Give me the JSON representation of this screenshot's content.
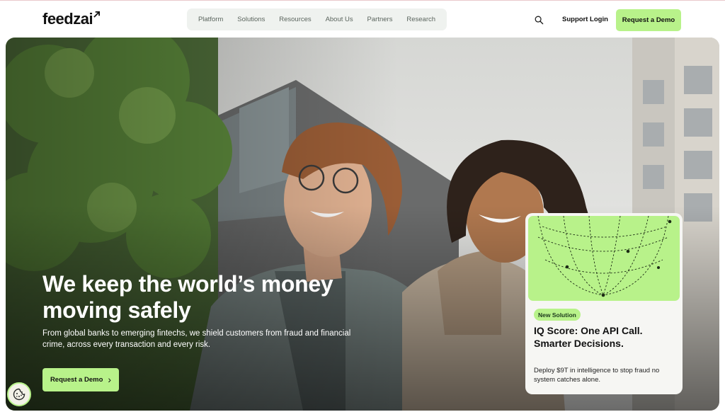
{
  "header": {
    "logo_text": "feedzai",
    "nav": [
      "Platform",
      "Solutions",
      "Resources",
      "About Us",
      "Partners",
      "Research"
    ],
    "support_label": "Support Login",
    "demo_label": "Request a Demo"
  },
  "hero": {
    "title": "We keep the world’s money moving safely",
    "subtitle": "From global banks to emerging fintechs, we shield customers from fraud and financial crime, across every transaction and every risk.",
    "cta_label": "Request a Demo"
  },
  "card": {
    "badge": "New Solution",
    "title": "IQ Score: One API Call. Smarter Decisions.",
    "text": "Deploy $9T in intelligence to stop fraud no system catches alone."
  },
  "colors": {
    "accent": "#b8f28a",
    "nav_bg": "#eff2ef",
    "text": "#111111"
  },
  "icons": {
    "search": "search-icon",
    "chevron": "chevron-right-icon",
    "cookie": "cookie-icon"
  }
}
